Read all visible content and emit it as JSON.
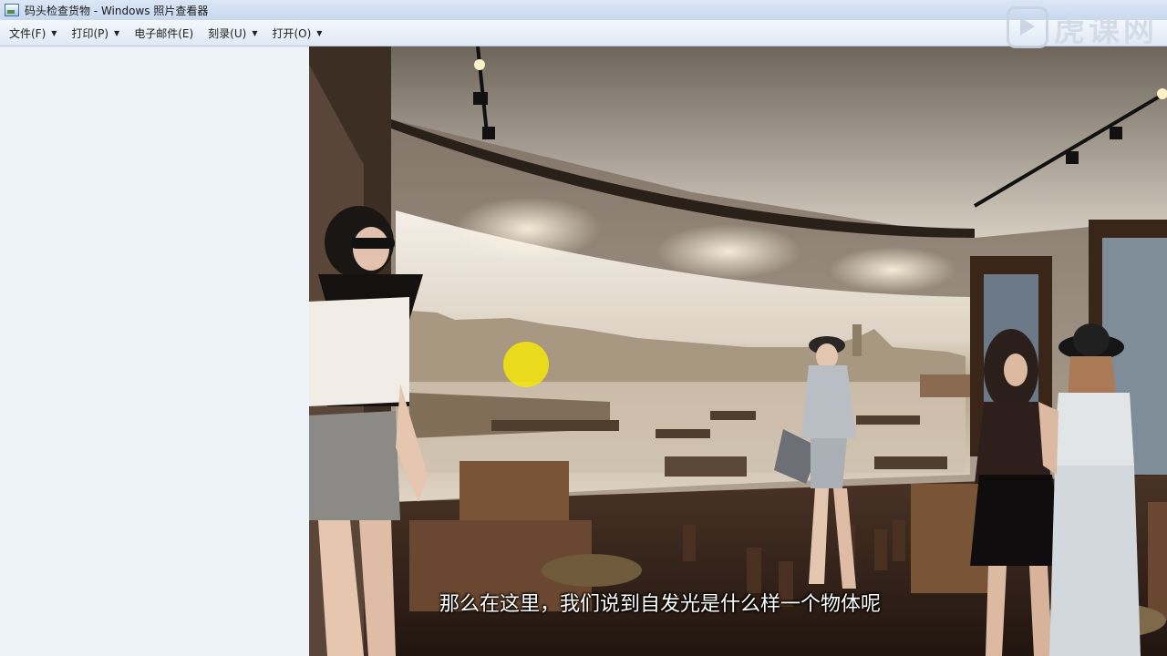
{
  "window": {
    "title": "码头检查货物 - Windows 照片查看器"
  },
  "menu": {
    "items": [
      {
        "label": "文件(F)",
        "has_dropdown": true
      },
      {
        "label": "打印(P)",
        "has_dropdown": true
      },
      {
        "label": "电子邮件(E)",
        "has_dropdown": false
      },
      {
        "label": "刻录(U)",
        "has_dropdown": true
      },
      {
        "label": "打开(O)",
        "has_dropdown": true
      }
    ]
  },
  "watermark": {
    "text": "虎课网",
    "icon": "play-logo-icon"
  },
  "photo": {
    "subtitle": "那么在这里，我们说到自发光是什么样一个物体呢",
    "description_icon": "rendered-interior-image"
  },
  "colors": {
    "titlebar": "#c7d8ee",
    "menubar": "#dfe9f5",
    "left_panel": "#eef3fa",
    "cursor_highlight": "#f5e60a"
  }
}
